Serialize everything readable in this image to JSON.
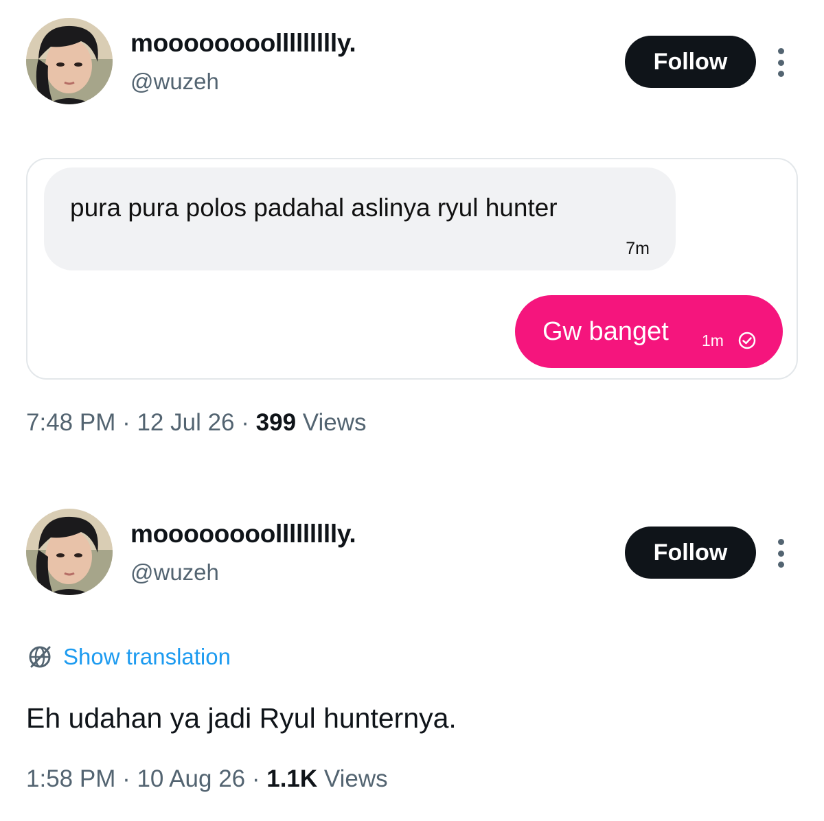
{
  "post1": {
    "display_name": "moooooooollllllllly.",
    "handle": "@wuzeh",
    "follow_label": "Follow",
    "chat": {
      "incoming_text": "pura pura polos padahal aslinya ryul hunter",
      "incoming_time": "7m",
      "outgoing_text": "Gw banget",
      "outgoing_time": "1m",
      "outgoing_color": "#f5157d"
    },
    "meta": {
      "time": "7:48 PM",
      "date": "12 Jul 26",
      "views_count": "399",
      "views_label": "Views"
    }
  },
  "post2": {
    "display_name": "moooooooollllllllly.",
    "handle": "@wuzeh",
    "follow_label": "Follow",
    "translate_label": "Show translation",
    "text": "Eh udahan ya jadi Ryul hunternya.",
    "meta": {
      "time": "1:58 PM",
      "date": "10 Aug 26",
      "views_count": "1.1K",
      "views_label": "Views"
    }
  },
  "separator": " · ",
  "colors": {
    "text_primary": "#0f1419",
    "text_secondary": "#536471",
    "link": "#1d9bf0",
    "follow_bg": "#0f1419"
  }
}
